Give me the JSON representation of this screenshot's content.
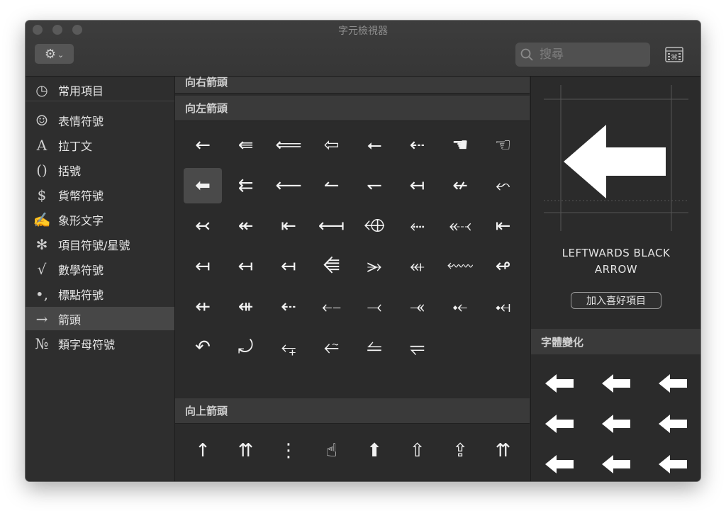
{
  "window": {
    "title": "字元檢視器"
  },
  "toolbar": {
    "gear_icon": "gear-icon",
    "search_placeholder": "搜尋",
    "keyboard_icon": "keyboard-viewer-icon"
  },
  "sidebar": {
    "items": [
      {
        "icon": "◷",
        "label": "常用項目"
      },
      {
        "icon": "☺",
        "label": "表情符號"
      },
      {
        "icon": "A",
        "label": "拉丁文"
      },
      {
        "icon": "()",
        "label": "括號"
      },
      {
        "icon": "$",
        "label": "貨幣符號"
      },
      {
        "icon": "✍",
        "label": "象形文字"
      },
      {
        "icon": "✻",
        "label": "項目符號/星號"
      },
      {
        "icon": "√",
        "label": "數學符號"
      },
      {
        "icon": "•,",
        "label": "標點符號"
      },
      {
        "icon": "→",
        "label": "箭頭"
      },
      {
        "icon": "№",
        "label": "類字母符號"
      }
    ],
    "active_index": 9
  },
  "sections": {
    "right": "向右箭頭",
    "left": "向左箭頭",
    "up": "向上箭頭"
  },
  "left_arrows": [
    "←",
    "⇚",
    "⟸",
    "⇦",
    "⭠",
    "⇠",
    "☚",
    "☜",
    "⬅",
    "⇇",
    "⟵",
    "↼",
    "↽",
    "↤",
    "↚",
    "⬿",
    "↢",
    "↞",
    "⇤",
    "⟻",
    "⬲",
    "⬸",
    "⬷",
    "⇤",
    "↤",
    "↤",
    "↤",
    "⭅",
    "⭃",
    "⬴",
    "⬳",
    "↫",
    "⇷",
    "⇺",
    "⇠",
    "⤌",
    "⤙",
    "⤛",
    "⤝",
    "⤟",
    "↶",
    "⤾",
    "⥆",
    "⭉",
    "⥪",
    "⥫"
  ],
  "up_arrows": [
    "↑",
    "⇈",
    "⋮",
    "☝",
    "⬆",
    "⇧",
    "⇪",
    "⇈",
    "↟",
    "↾",
    "↿",
    "⤒",
    "⥉",
    "↾",
    "↿",
    "⟰"
  ],
  "selected_index": 8,
  "detail": {
    "name_line1": "LEFTWARDS BLACK",
    "name_line2": "ARROW",
    "favorite_button": "加入喜好項目",
    "variants_header": "字體變化",
    "variants": [
      "⬅",
      "⬅",
      "⬅",
      "⬅",
      "⬅",
      "⬅",
      "⬅",
      "⬅",
      "⬅"
    ]
  }
}
